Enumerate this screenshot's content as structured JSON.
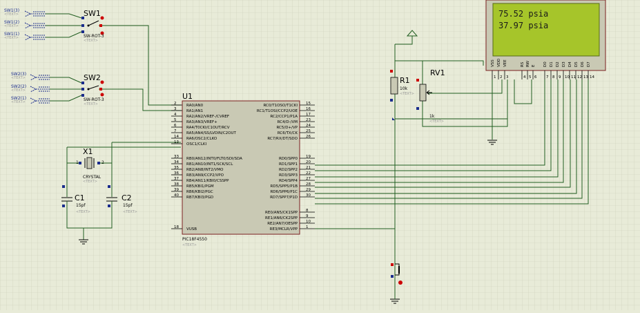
{
  "lcd": {
    "line1": "75.52 psia",
    "line2": "37.97 psia",
    "pins": [
      "VSS",
      "VDD",
      "VEE",
      "RS",
      "RW",
      "E",
      "D0",
      "D1",
      "D2",
      "D3",
      "D4",
      "D5",
      "D6",
      "D7"
    ],
    "pin_numbers": [
      "1",
      "2",
      "3",
      "4",
      "5",
      "6",
      "7",
      "8",
      "9",
      "10",
      "11",
      "12",
      "13",
      "14"
    ]
  },
  "switches": {
    "sw1": {
      "name": "SW1",
      "part": "SW-ROT-3",
      "text": "<TEXT>",
      "terminals": [
        "SW1(3)",
        "SW1(2)",
        "SW1(1)"
      ]
    },
    "sw2": {
      "name": "SW2",
      "part": "SW-ROT-3",
      "text": "<TEXT>",
      "terminals": [
        "SW2(3)",
        "SW2(2)",
        "SW2(1)"
      ]
    }
  },
  "terminal_text": "<TEXT>",
  "crystal": {
    "name": "X1",
    "part": "CRYSTAL",
    "text": "<TEXT>",
    "pin1": "1",
    "pin2": "2"
  },
  "caps": [
    {
      "name": "C1",
      "value": "15pf",
      "text": "<TEXT>"
    },
    {
      "name": "C2",
      "value": "15pf",
      "text": "<TEXT>"
    }
  ],
  "r1": {
    "name": "R1",
    "value": "10k",
    "text": "<TEXT>"
  },
  "rv1": {
    "name": "RV1",
    "value": "1k",
    "text": "<TEXT>"
  },
  "mcu": {
    "name": "U1",
    "part": "PIC18F4550",
    "text": "<TEXT>",
    "left_pins": [
      {
        "num": "2",
        "label": "RA0/AN0"
      },
      {
        "num": "3",
        "label": "RA1/AN1"
      },
      {
        "num": "4",
        "label": "RA2/AN2/VREF-/CVREF"
      },
      {
        "num": "5",
        "label": "RA3/AN3/VREF+"
      },
      {
        "num": "6",
        "label": "RA4/T0CKI/C1OUT/RCV"
      },
      {
        "num": "7",
        "label": "RA5/AN4/SS/LVDIN/C2OUT"
      },
      {
        "num": "14",
        "label": "RA6/OSC2/CLKO"
      },
      {
        "num": "13",
        "label": "OSC1/CLKI"
      },
      {
        "num": "33",
        "label": "RB0/AN12/INT0/FLT0/SDI/SDA"
      },
      {
        "num": "34",
        "label": "RB1/AN10/INT1/SCK/SCL"
      },
      {
        "num": "35",
        "label": "RB2/AN8/INT2/VMO"
      },
      {
        "num": "36",
        "label": "RB3/AN9/CCP2/VPO"
      },
      {
        "num": "37",
        "label": "RB4/AN11/KBI0/CSSPP"
      },
      {
        "num": "38",
        "label": "RB5/KBI1/PGM"
      },
      {
        "num": "39",
        "label": "RB6/KBI2/PGC"
      },
      {
        "num": "40",
        "label": "RB7/KBI3/PGD"
      },
      {
        "num": "18",
        "label": "VUSB"
      }
    ],
    "right_pins": [
      {
        "num": "15",
        "label": "RC0/T1OSO/T1CKI"
      },
      {
        "num": "16",
        "label": "RC1/T1OSI/CCP2/UOE"
      },
      {
        "num": "17",
        "label": "RC2/CCP1/P1A"
      },
      {
        "num": "23",
        "label": "RC4/D-/VM"
      },
      {
        "num": "24",
        "label": "RC5/D+/VP"
      },
      {
        "num": "25",
        "label": "RC6/TX/CK"
      },
      {
        "num": "26",
        "label": "RC7/RX/DT/SDO"
      },
      {
        "num": "19",
        "label": "RD0/SPP0"
      },
      {
        "num": "20",
        "label": "RD1/SPP1"
      },
      {
        "num": "21",
        "label": "RD2/SPP2"
      },
      {
        "num": "22",
        "label": "RD3/SPP3"
      },
      {
        "num": "27",
        "label": "RD4/SPP4"
      },
      {
        "num": "28",
        "label": "RD5/SPP5/P1B"
      },
      {
        "num": "29",
        "label": "RD6/SPP6/P1C"
      },
      {
        "num": "30",
        "label": "RD7/SPP7/P1D"
      },
      {
        "num": "8",
        "label": "RE0/AN5/CK1SPP"
      },
      {
        "num": "9",
        "label": "RE1/AN6/CK2SPP"
      },
      {
        "num": "10",
        "label": "RE2/AN7/OESPP"
      },
      {
        "num": "1",
        "label": "RE3/MCLR/VPP"
      }
    ]
  }
}
